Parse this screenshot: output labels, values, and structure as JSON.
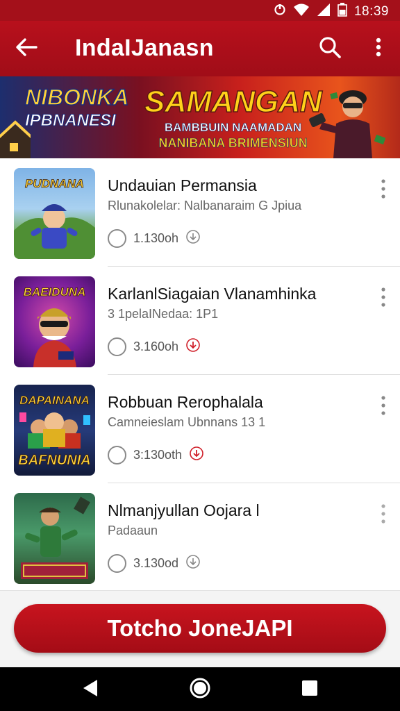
{
  "status_bar": {
    "time": "18:39",
    "icons": [
      "sync-icon",
      "wifi-icon",
      "signal-icon",
      "battery-icon"
    ]
  },
  "app_bar": {
    "title": "IndaIJanasn",
    "back_icon": "back-arrow-icon",
    "search_icon": "search-icon",
    "more_icon": "more-vert-icon"
  },
  "banner": {
    "left_line1": "NIBONKA",
    "left_line2": "IPBNANESI",
    "headline": "SAMANGAN",
    "subline1": "BAMBBUIN NAAMADAN",
    "subline2": "NANIBANA BRIMENSIUN"
  },
  "items": [
    {
      "title": "Undauian Permansia",
      "subtitle": "Rlunakolelar: Nalbanaraim G Jpiua",
      "meta": "1.130oh",
      "thumb_top": "PUDNANA",
      "thumb_bottom": "",
      "meta_icon": "download-icon",
      "meta_icon_color": "#888888"
    },
    {
      "title": "KarlanlSiagaian Vlanamhinka",
      "subtitle": "3 1pelaINedaa: 1P1",
      "meta": "3.160oh",
      "thumb_top": "BAEIDUNA",
      "thumb_bottom": "",
      "meta_icon": "download-icon",
      "meta_icon_color": "#d0202a"
    },
    {
      "title": "Robbuan Rerophalala",
      "subtitle": "Camneieslam Ubnnans 13 1",
      "meta": "3:130oth",
      "thumb_top": "DAPAINANA",
      "thumb_bottom": "BAFNUNIA",
      "meta_icon": "download-icon",
      "meta_icon_color": "#d0202a"
    },
    {
      "title": "Nlmanjyullan Oojara l",
      "subtitle": "Padaaun",
      "meta": "3.130od",
      "thumb_top": "",
      "thumb_bottom": "",
      "meta_icon": "download-icon",
      "meta_icon_color": "#888888"
    }
  ],
  "cta": {
    "label": "Totcho JoneJAPI"
  },
  "nav": {
    "back_icon": "nav-back-icon",
    "home_icon": "nav-home-icon",
    "recents_icon": "nav-recents-icon"
  },
  "colors": {
    "primary": "#b8101c",
    "accent": "#d0202a",
    "background": "#ffffff"
  }
}
